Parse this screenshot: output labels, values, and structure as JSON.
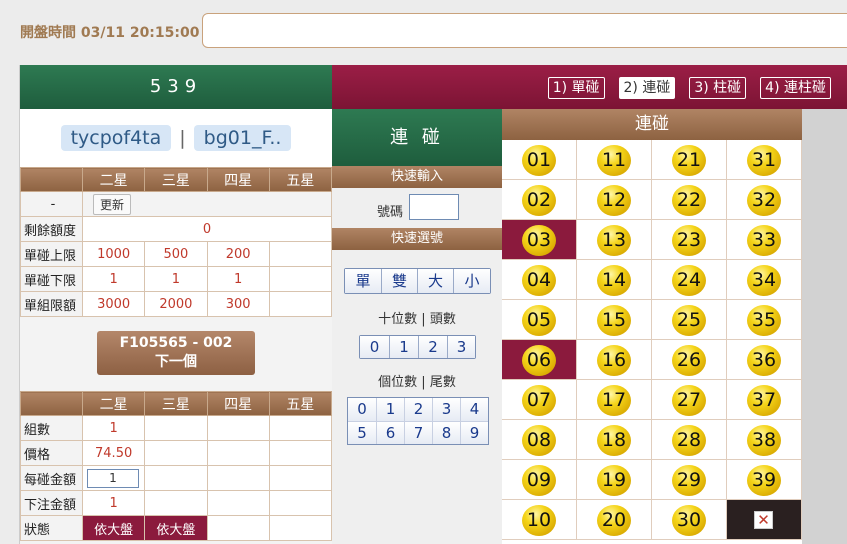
{
  "header": {
    "open_time": "開盤時間 03/11 20:15:00"
  },
  "game": {
    "title": "539",
    "user1": "tycpof4ta",
    "separator": "|",
    "user2": "bg01_F.."
  },
  "limits_table": {
    "columns": [
      "二星",
      "三星",
      "四星",
      "五星"
    ],
    "dash": "-",
    "update_label": "更新",
    "rows": [
      {
        "label": "剩餘額度",
        "value": "0"
      },
      {
        "label": "單碰上限",
        "values": [
          "1000",
          "500",
          "200",
          ""
        ]
      },
      {
        "label": "單碰下限",
        "values": [
          "1",
          "1",
          "1",
          ""
        ]
      },
      {
        "label": "單組限額",
        "values": [
          "3000",
          "2000",
          "300",
          ""
        ]
      }
    ]
  },
  "next_button": {
    "line1": "F105565 - 002",
    "line2": "下一個"
  },
  "bet_table": {
    "columns": [
      "二星",
      "三星",
      "四星",
      "五星"
    ],
    "rows": [
      {
        "label": "組數",
        "values": [
          "1",
          "",
          "",
          ""
        ]
      },
      {
        "label": "價格",
        "values": [
          "74.50",
          "",
          "",
          ""
        ]
      },
      {
        "label": "每碰金額",
        "input": "1"
      },
      {
        "label": "下注金額",
        "values": [
          "1",
          "",
          "",
          ""
        ]
      },
      {
        "label": "狀態",
        "values": [
          "依大盤",
          "依大盤",
          "",
          ""
        ]
      }
    ]
  },
  "modes": [
    "1) 單碰",
    "2) 連碰",
    "3) 柱碰",
    "4) 連柱碰"
  ],
  "active_mode": 1,
  "middle": {
    "title": "連 碰",
    "quick_input": "快速輸入",
    "number_label": "號碼",
    "quick_select": "快速選號",
    "type_buttons": [
      "單",
      "雙",
      "大",
      "小"
    ],
    "tens_label": "十位數 | 頭數",
    "tens_digits": [
      "0",
      "1",
      "2",
      "3"
    ],
    "units_label": "個位數 | 尾數",
    "units_digits": [
      "0",
      "1",
      "2",
      "3",
      "4",
      "5",
      "6",
      "7",
      "8",
      "9"
    ]
  },
  "board": {
    "title": "連碰",
    "numbers": [
      [
        "01",
        "11",
        "21",
        "31"
      ],
      [
        "02",
        "12",
        "22",
        "32"
      ],
      [
        "03",
        "13",
        "23",
        "33"
      ],
      [
        "04",
        "14",
        "24",
        "34"
      ],
      [
        "05",
        "15",
        "25",
        "35"
      ],
      [
        "06",
        "16",
        "26",
        "36"
      ],
      [
        "07",
        "17",
        "27",
        "37"
      ],
      [
        "08",
        "18",
        "28",
        "38"
      ],
      [
        "09",
        "19",
        "29",
        "39"
      ],
      [
        "10",
        "20",
        "30",
        ""
      ]
    ],
    "selected": [
      "03",
      "06"
    ],
    "clear_symbol": "✕"
  },
  "colors": {
    "green": "#1e5d3d",
    "maroon": "#8b1a3d",
    "brown": "#8d6241",
    "ball": "#f5d51a"
  }
}
